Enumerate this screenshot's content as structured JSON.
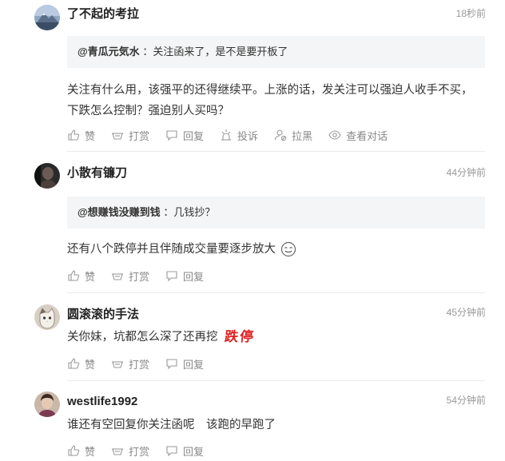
{
  "comments": [
    {
      "username": "了不起的考拉",
      "avatar": "mountain-avatar",
      "time": "18秒前",
      "quote_name": "@青瓜元気水",
      "quote_sep": "：",
      "quote_text": "关注函来了，是不是要开板了",
      "text": "关注有什么用，该强平的还得继续平。上涨的话，发关注可以强迫人收手不买，下跌怎么控制？强迫别人买吗？",
      "actions": {
        "like": "赞",
        "tip": "打赏",
        "reply": "回复",
        "report": "投诉",
        "block": "拉黑",
        "conversation": "查看对话"
      }
    },
    {
      "username": "小散有镰刀",
      "avatar": "dark-avatar",
      "time": "44分钟前",
      "quote_name": "@想赚钱没赚到钱",
      "quote_sep": "：",
      "quote_text": "几钱抄？",
      "text": "还有八个跌停并且伴随成交量要逐步放大",
      "emoji": "smile-emoji",
      "actions": {
        "like": "赞",
        "tip": "打赏",
        "reply": "回复"
      }
    },
    {
      "username": "圆滚滚的手法",
      "avatar": "cat-avatar",
      "time": "45分钟前",
      "text": "关你妹，坑都怎么深了还再挖",
      "stamp": "跌停",
      "actions": {
        "like": "赞",
        "tip": "打赏",
        "reply": "回复"
      }
    },
    {
      "username": "westlife1992",
      "avatar": "portrait-avatar",
      "time": "54分钟前",
      "text": "谁还有空回复你关注函呢　该跑的早跑了",
      "actions": {
        "like": "赞",
        "tip": "打赏",
        "reply": "回复"
      }
    }
  ],
  "colors": {
    "text": "#333333",
    "muted": "#999999",
    "action": "#888888",
    "quote_bg": "#f4f5f6",
    "stamp": "#e02020"
  }
}
